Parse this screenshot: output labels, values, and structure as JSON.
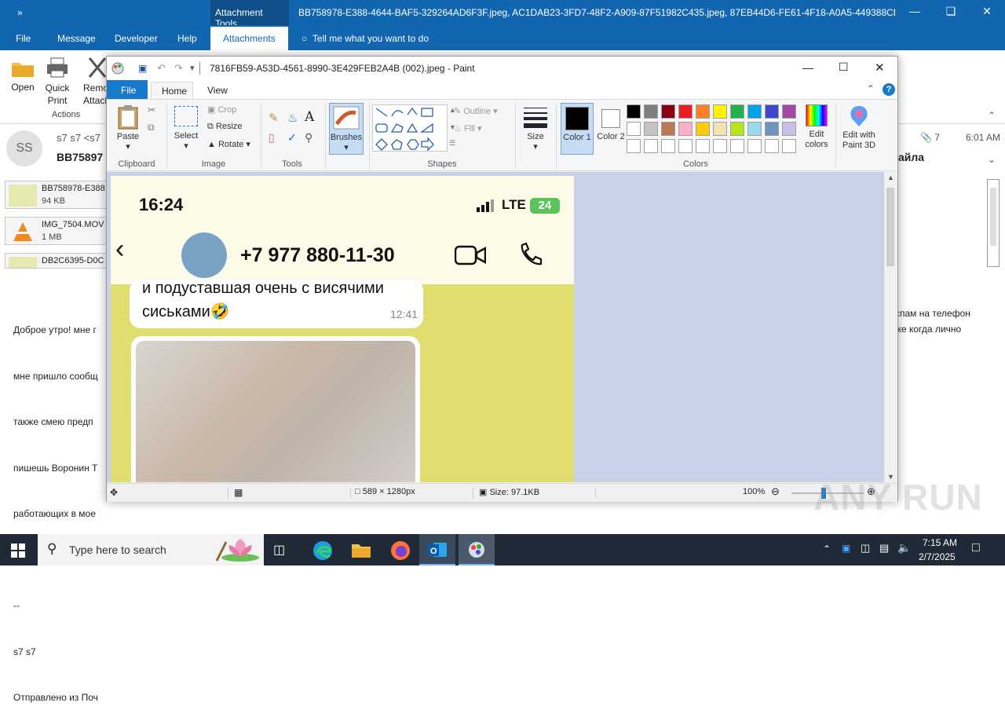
{
  "outlook": {
    "title_quick": "»",
    "context_tab": "Attachment Tools",
    "window_title": "BB758978-E388-4644-BAF5-329264AD6F3F.jpeg, AC1DAB23-3FD7-48F2-A909-87F51982C435.jpeg, 87EB44D6-FE61-4F18-A0A5-449388CD37F2....",
    "tabs": [
      "File",
      "Message",
      "Developer",
      "Help",
      "Attachments"
    ],
    "tell_me": "Tell me what you want to do",
    "ribbon": {
      "open": "Open",
      "quick_print": "Quick Print",
      "remove": "Remove Attach",
      "group_actions": "Actions"
    },
    "sender_initials": "SS",
    "sender_line": "s7 s7 <s7",
    "subject_partial": "BB75897",
    "attachment_count": "7",
    "time": "6:01 AM",
    "right_subject": "айла",
    "attachments": [
      {
        "name": "BB758978-E388",
        "size": "94 KB"
      },
      {
        "name": "IMG_7504.MOV",
        "size": "1 MB"
      },
      {
        "name": "DB2C6395-D0C",
        "size": ""
      }
    ],
    "body_lines": [
      "Доброе утро! мне г",
      "мне пришло сообщ",
      "также смею предп",
      "пишешь Воронин Т",
      "работающих в мое",
      "",
      "--",
      "s7 s7",
      "Отправлено из Поч"
    ],
    "right_lines": [
      "спам на телефон",
      "же когда лично"
    ]
  },
  "paint": {
    "title": "7816FB59-A53D-4561-8990-3E429FEB2A4B (002).jpeg - Paint",
    "tabs": [
      "File",
      "Home",
      "View"
    ],
    "clipboard": {
      "paste": "Paste",
      "label": "Clipboard"
    },
    "image": {
      "select": "Select",
      "crop": "Crop",
      "resize": "Resize",
      "rotate": "Rotate",
      "label": "Image"
    },
    "tools": {
      "label": "Tools"
    },
    "brushes": "Brushes",
    "shapes": {
      "outline": "Outline",
      "fill": "Fill",
      "label": "Shapes"
    },
    "size": "Size",
    "color1": "Color 1",
    "color2": "Color 2",
    "colors_label": "Colors",
    "edit_colors": "Edit colors",
    "edit_3d": "Edit with Paint 3D",
    "palette": [
      "#000000",
      "#7f7f7f",
      "#880015",
      "#ed1c24",
      "#ff7f27",
      "#fff200",
      "#22b14c",
      "#00a2e8",
      "#3f48cc",
      "#a349a4",
      "#ffffff",
      "#c3c3c3",
      "#b97a57",
      "#ffaec9",
      "#ffc90e",
      "#efe4b0",
      "#b5e61d",
      "#99d9ea",
      "#7092be",
      "#c8bfe7"
    ],
    "status": {
      "dimensions": "589 × 1280px",
      "size": "Size: 97.1KB",
      "zoom": "100%"
    }
  },
  "phone": {
    "time": "16:24",
    "network": "LTE",
    "battery": "24",
    "contact": "+7 977 880-11-30",
    "msg_line1": "и подуставшая очень с висячими",
    "msg_line2": "сиськами🤣",
    "msg_time": "12:41"
  },
  "taskbar": {
    "search_placeholder": "Type here to search",
    "clock_time": "7:15 AM",
    "clock_date": "2/7/2025"
  },
  "watermark": "ANY RUN"
}
